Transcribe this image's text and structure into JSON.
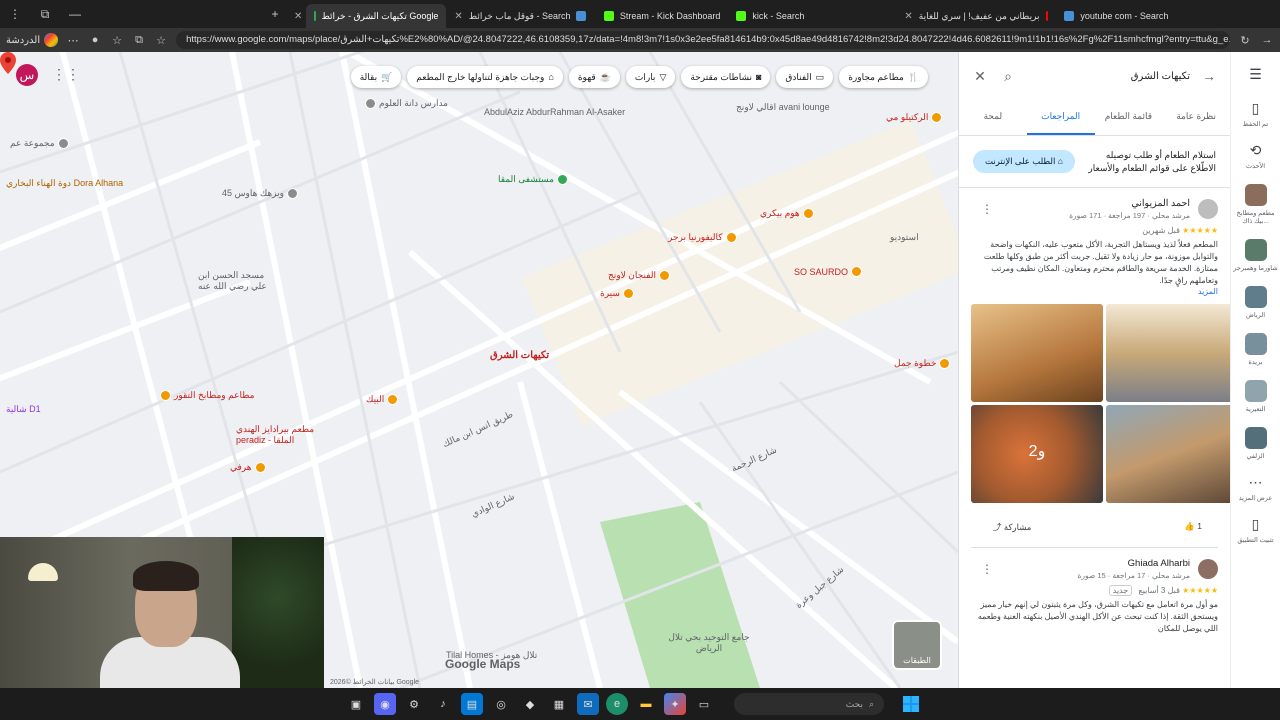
{
  "browser": {
    "tabs": [
      {
        "title": "تكيهات الشرق - خرائط Google",
        "active": true
      },
      {
        "title": "قوقل ماب خرائط - Search",
        "active": false
      },
      {
        "title": "Stream - Kick Dashboard",
        "active": false
      },
      {
        "title": "kick - Search",
        "active": false
      },
      {
        "title": "بريطاني من عفيف! | سري للغاية",
        "active": false
      },
      {
        "title": "youtube com - Search",
        "active": false
      }
    ],
    "url": "https://www.google.com/maps/place/تكيهات+الشرق%E2%80%AD/@24.8047222,46.6108359,17z/data=!4m8!3m7!1s0x3e2ee5fa814614b9:0x45d8ae49d4816742!8m2!3d24.8047222!4d46.6082611!9m1!1b1!16s%2Fg%2F11smhcfmgl?entry=ttu&g_e...",
    "chat_label": "الدردشة"
  },
  "map": {
    "chips": [
      "مطاعم مجاورة",
      "الفنادق",
      "نشاطات مقترحة",
      "بارات",
      "قهوة",
      "وجبات جاهزة لتناولها خارج المطعم",
      "بقالة"
    ],
    "labels": [
      "مدارس دانة العلوم",
      "AbdulAziz AbdurRahman Al-Asaker",
      "اقالي لاونج avani lounge",
      "الركتيلو مي",
      "مجموعة عم",
      "دوة الهناء البخاري Dora Alhana",
      "ويزهك هاوس 45",
      "مستشفى المقا",
      "كاليفورنيا برجر",
      "هوم بيكري",
      "الفنجان لاونج",
      "سيرة",
      "SO SAURDO",
      "استوديو",
      "مسجد الحسن ابن علي رضي الله عنه",
      "مطاعم ومطابخ التقور",
      "مطعم بيرادايز الهندي peradiz - الملقا",
      "البيك",
      "هرفي",
      "شالية D1",
      "خطوة جمل",
      "طريق انس ابن مالك",
      "شارع الوادي",
      "شارع الرحمة",
      "شارع جبل وعرة",
      "جامع التوحيد بحي تلال الرياض",
      "Tilal Homes - تلال هومز"
    ],
    "pin_label": "تكيهات الشرق",
    "google_logo": "Google Maps",
    "attribution": "بيانات الخرائط ©2026 Google",
    "layers_label": "الطبقات",
    "avatar_letter": "س"
  },
  "panel": {
    "search_query": "تكيهات الشرق",
    "tabs": [
      "نظرة عامة",
      "قائمة الطعام",
      "المراجعات",
      "لمحة"
    ],
    "active_tab": "المراجعات",
    "order_text": "استلام الطعام أو طلب توصيله الاطّلاع على قوائم الطعام والأسعار",
    "order_button": "الطلب على الإنترنت",
    "reviews": [
      {
        "name": "احمد المزيواني",
        "meta": "مرشد محلي · 197 مراجعة · 171 صورة",
        "stars": "★★★★★",
        "time": "قبل شهرين",
        "text": "المطعم فعلاً لذيذ ويستاهل التجربة، الأكل متعوب عليه، النكهات واضحة والتوابل موزونة، مو حار زيادة ولا ثقيل. جربت أكثر من طبق وكلها طلعت ممتازة. الخدمة سريعة والطاقم محترم ومتعاون. المكان نظيف ومرتب وتعاملهم راقٍ جدًا.",
        "more": "المزيد",
        "photos_more": "و2",
        "likes": "1",
        "share": "مشاركة"
      },
      {
        "name": "Ghiada Alharbi",
        "meta": "مرشد محلي · 17 مراجعة · 15 صورة",
        "stars": "★★★★★",
        "time": "قبل 3 أسابيع",
        "badge": "جديد",
        "text": "مو أول مرة اتعامل مع تكيهات الشرق، وكل مرة يثبتون لي إنهم خيار مميز ويستحق الثقة. إذا كنت تبحث عن الأكل الهندي الأصيل بنكهته الغنية وطعمه اللي يوصل للمكان"
      }
    ]
  },
  "rail": {
    "items": [
      {
        "icon": "menu-icon",
        "label": ""
      },
      {
        "icon": "bookmark-icon",
        "label": "تم الحفظ"
      },
      {
        "icon": "history-icon",
        "label": "الأحدث"
      },
      {
        "icon": "thumb",
        "label": "مطعم ومطابخ بيك ذاك..."
      },
      {
        "icon": "thumb",
        "label": "شاورما وهمبرجر"
      },
      {
        "icon": "thumb",
        "label": "الرياض"
      },
      {
        "icon": "thumb",
        "label": "بريدة"
      },
      {
        "icon": "thumb",
        "label": "النعيرية"
      },
      {
        "icon": "thumb",
        "label": "الزلفي"
      },
      {
        "icon": "more-icon",
        "label": "عرض المزيد"
      },
      {
        "icon": "phone-icon",
        "label": "تثبيت التطبيق"
      }
    ]
  },
  "taskbar": {
    "search_placeholder": "بحث"
  },
  "colors": {
    "accent": "#1a73e8",
    "pin": "#ea4335",
    "poi": "#f29900"
  }
}
